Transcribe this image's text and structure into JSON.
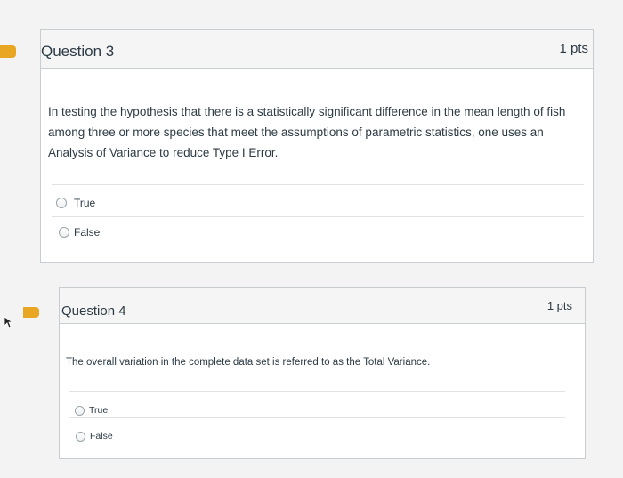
{
  "colors": {
    "flag": "#e8a623",
    "header_bg": "#f5f5f5",
    "border": "#c7cdd1",
    "text": "#2d3b45"
  },
  "questions": [
    {
      "title": "Question 3",
      "points": "1 pts",
      "text": "In testing the hypothesis that there is a statistically significant difference in the mean length of fish among three or more species that meet the assumptions of parametric statistics, one uses an Analysis of Variance to reduce Type I Error.",
      "answers": [
        "True",
        "False"
      ],
      "icon": "flag-icon"
    },
    {
      "title": "Question 4",
      "points": "1 pts",
      "text": "The overall variation in the complete data set is referred to as the Total Variance.",
      "answers": [
        "True",
        "False"
      ],
      "icon": "flag-icon"
    }
  ],
  "cursor_icon": "mouse-pointer-icon"
}
